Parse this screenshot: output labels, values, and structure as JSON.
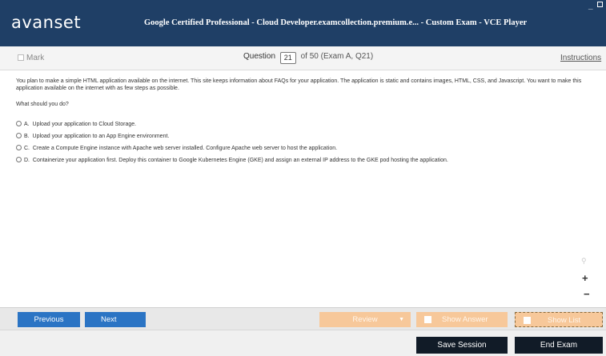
{
  "app": {
    "brand": "avanset",
    "window_title": "Google Certified Professional - Cloud Developer.examcollection.premium.e... - Custom Exam - VCE Player"
  },
  "header": {
    "mark_label": "Mark",
    "question_label": "Question",
    "question_number": "21",
    "question_suffix": "of 50 (Exam A, Q21)",
    "instructions_label": "Instructions"
  },
  "question": {
    "text": "You plan to make a simple HTML application available on the internet. This site keeps information about FAQs for your application. The application is static and contains images, HTML, CSS, and Javascript. You want to make this application available on the internet with as few steps as possible.",
    "prompt": "What should you do?",
    "options": [
      {
        "letter": "A.",
        "text": "Upload your application to Cloud Storage."
      },
      {
        "letter": "B.",
        "text": "Upload your application to an App Engine environment."
      },
      {
        "letter": "C.",
        "text": "Create a Compute Engine instance with Apache web server installed. Configure Apache web server to host the application."
      },
      {
        "letter": "D.",
        "text": "Containerize your application first. Deploy this container to Google Kubernetes Engine (GKE) and assign an external IP address to the GKE pod hosting the application."
      }
    ]
  },
  "zoom": {
    "plus": "+",
    "minus": "−"
  },
  "nav": {
    "previous": "Previous",
    "next": "Next",
    "review": "Review",
    "show_answer": "Show Answer",
    "show_list": "Show List"
  },
  "session": {
    "save": "Save Session",
    "end": "End Exam"
  },
  "colors": {
    "titlebar": "#1f3f66",
    "nav_blue": "#2b74c4",
    "nav_orange": "#f7c89a",
    "session_dark": "#111b27"
  }
}
